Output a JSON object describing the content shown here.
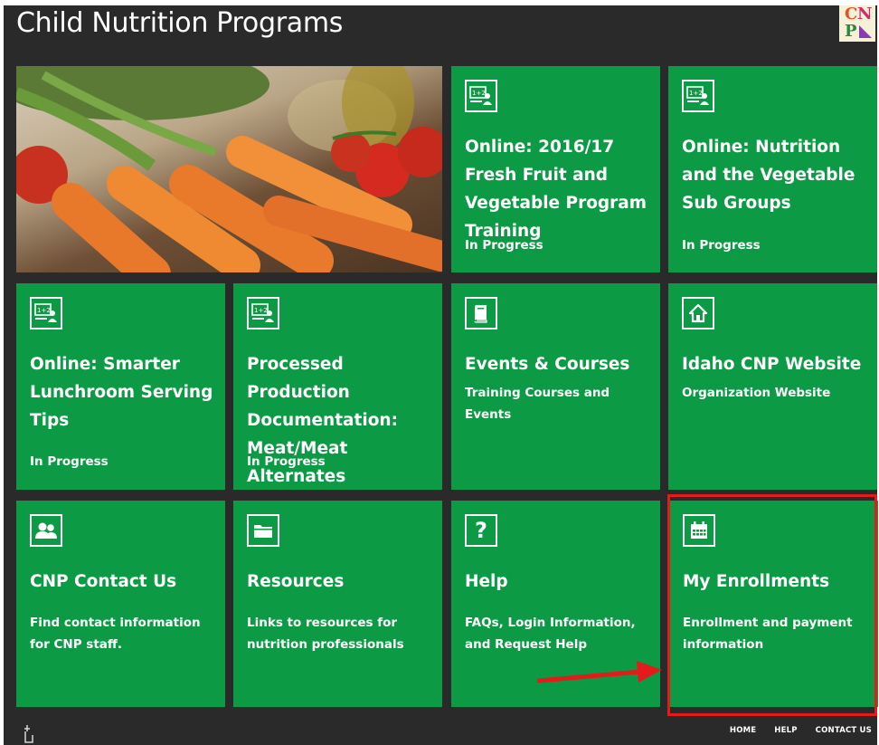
{
  "header": {
    "title": "Child Nutrition Programs",
    "logo_letters": {
      "c": "C",
      "n": "N",
      "p": "P"
    }
  },
  "tiles": [
    {
      "icon": "classroom-icon",
      "title": "Online: 2016/17 Fresh Fruit and Vegetable Program Training",
      "subtitle": "In Progress"
    },
    {
      "icon": "classroom-icon",
      "title": "Online: Nutrition and the Vegetable Sub Groups",
      "subtitle": "In Progress"
    },
    {
      "icon": "classroom-icon",
      "title": "Online: Smarter Lunchroom Serving Tips",
      "subtitle": "In Progress"
    },
    {
      "icon": "classroom-icon",
      "title": "Processed Production Documentation: Meat/Meat Alternates",
      "subtitle": "In Progress"
    },
    {
      "icon": "book-icon",
      "title": "Events & Courses",
      "subtitle": "Training Courses and Events"
    },
    {
      "icon": "home-icon",
      "title": "Idaho CNP Website",
      "subtitle": "Organization Website"
    },
    {
      "icon": "contacts-icon",
      "title": "CNP Contact Us",
      "subtitle": "Find contact information for CNP staff."
    },
    {
      "icon": "folder-icon",
      "title": "Resources",
      "subtitle": "Links to resources for nutrition professionals"
    },
    {
      "icon": "question-icon",
      "title": "Help",
      "subtitle": "FAQs, Login Information, and Request Help"
    },
    {
      "icon": "calendar-icon",
      "title": "My Enrollments",
      "subtitle": "Enrollment and payment information"
    }
  ],
  "footer": {
    "links": [
      "HOME",
      "HELP",
      "CONTACT US"
    ]
  },
  "colors": {
    "tile_green": "#0c9a45",
    "background": "#2a2a2a",
    "highlight": "#e51a1a"
  }
}
